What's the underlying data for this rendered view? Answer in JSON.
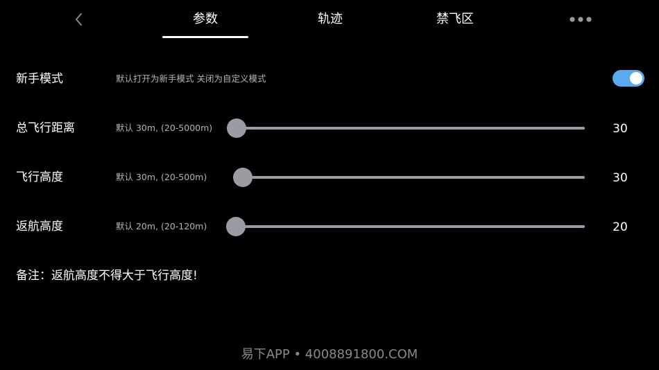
{
  "header": {
    "tabs": [
      {
        "label": "参数",
        "active": true
      },
      {
        "label": "轨迹",
        "active": false
      },
      {
        "label": "禁飞区",
        "active": false
      }
    ],
    "back_icon": "chevron-left-icon",
    "more_icon": "more-dots-icon"
  },
  "settings": {
    "novice_mode": {
      "label": "新手模式",
      "description": "默认打开为新手模式 关闭为自定义模式",
      "enabled": true,
      "toggle_color": "#5aaaf0"
    },
    "total_distance": {
      "label": "总飞行距离",
      "description": "默认 30m, (20-5000m)",
      "value": "30",
      "min": 20,
      "max": 5000
    },
    "flight_height": {
      "label": "飞行高度",
      "description": "默认 30m, (20-500m)",
      "value": "30",
      "min": 20,
      "max": 500
    },
    "return_height": {
      "label": "返航高度",
      "description": "默认 20m, (20-120m)",
      "value": "20",
      "min": 20,
      "max": 120
    }
  },
  "note": "备注：返航高度不得大于飞行高度!",
  "watermark": "易下APP • 4008891800.COM",
  "colors": {
    "background": "#000000",
    "slider": "#9a9ca3",
    "accent": "#5aaaf0"
  }
}
